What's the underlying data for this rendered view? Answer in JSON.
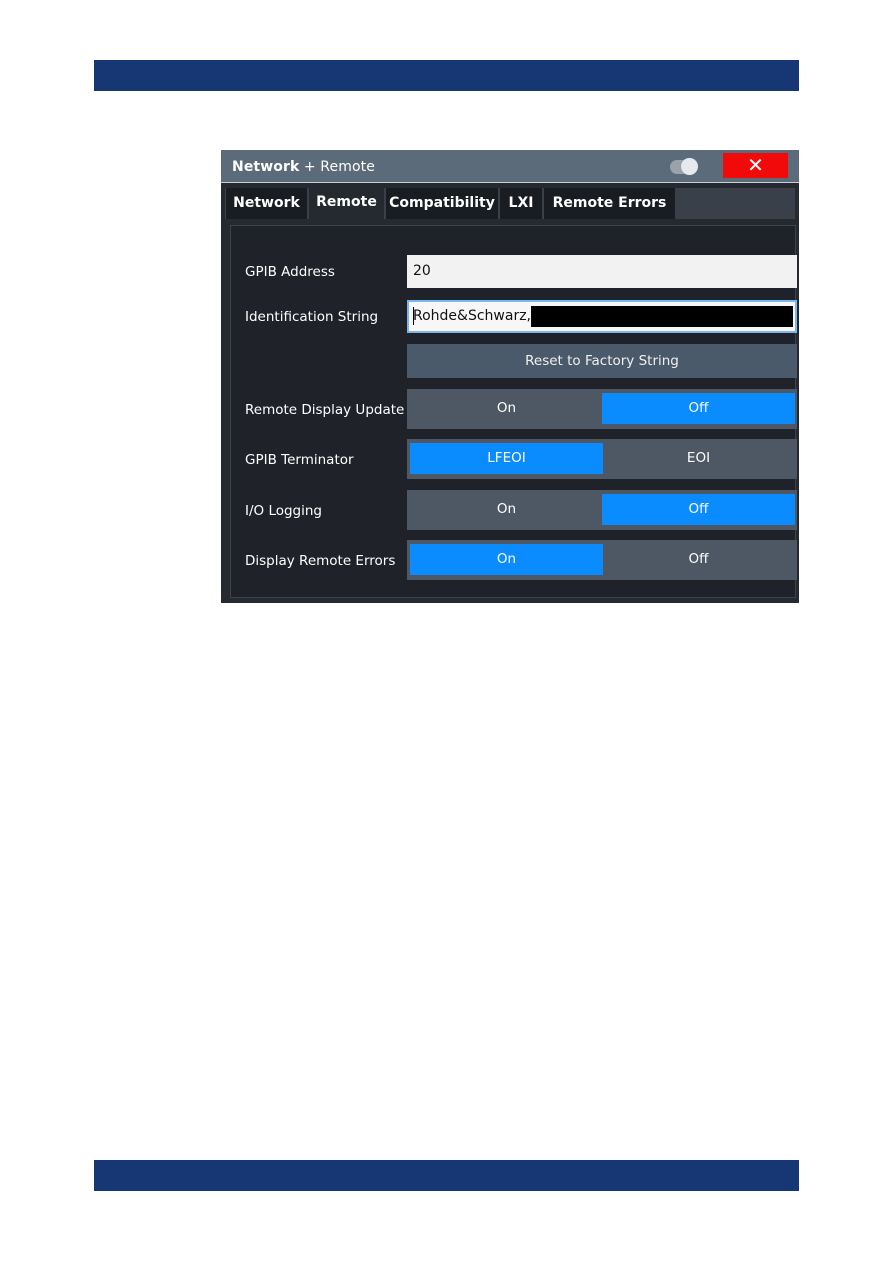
{
  "colors": {
    "page_bar": "#173674",
    "titlebar": "#5b6b7a",
    "close_button": "#f20a0a",
    "selected_option": "#0a8cff",
    "option_background": "#4d5864",
    "dialog_background": "#252a31"
  },
  "dialog": {
    "title_bold": "Network",
    "title_rest": " + Remote",
    "close_label": "✕",
    "tabs": [
      {
        "label": "Network",
        "active": false
      },
      {
        "label": "Remote",
        "active": true
      },
      {
        "label": "Compatibility",
        "active": false
      },
      {
        "label": "LXI",
        "active": false
      },
      {
        "label": "Remote Errors",
        "active": false
      }
    ]
  },
  "remote": {
    "gpib_address": {
      "label": "GPIB Address",
      "value": "20"
    },
    "identification_string": {
      "label": "Identification String",
      "value": "Rohde&Schwarz,",
      "redacted_suffix": true
    },
    "reset_button": "Reset to Factory String",
    "remote_display_update": {
      "label": "Remote Display Update",
      "options": [
        "On",
        "Off"
      ],
      "selected": "Off"
    },
    "gpib_terminator": {
      "label": "GPIB Terminator",
      "options": [
        "LFEOI",
        "EOI"
      ],
      "selected": "LFEOI"
    },
    "io_logging": {
      "label": "I/O Logging",
      "options": [
        "On",
        "Off"
      ],
      "selected": "Off"
    },
    "display_remote_errors": {
      "label": "Display Remote Errors",
      "options": [
        "On",
        "Off"
      ],
      "selected": "On"
    }
  }
}
